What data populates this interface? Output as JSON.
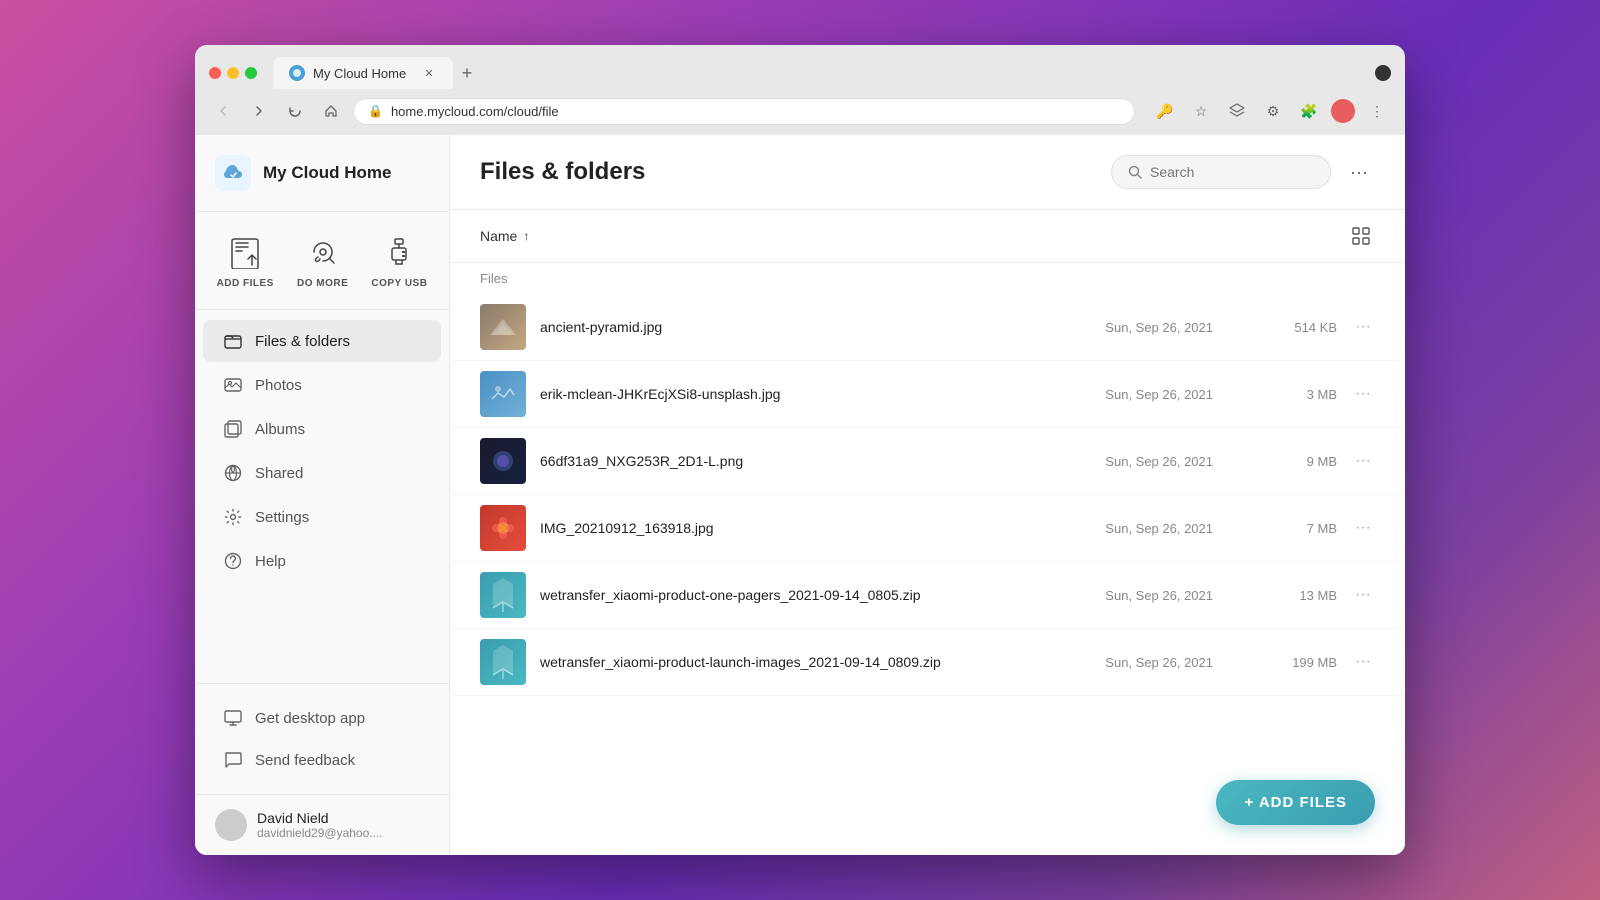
{
  "browser": {
    "tab_title": "My Cloud Home",
    "url": "home.mycloud.com/cloud/file",
    "new_tab_symbol": "+",
    "back_btn": "←",
    "forward_btn": "→",
    "refresh_btn": "↻",
    "home_btn": "⌂"
  },
  "sidebar": {
    "logo_text": "My Cloud Home",
    "actions": [
      {
        "id": "add-files",
        "label": "ADD FILES"
      },
      {
        "id": "do-more",
        "label": "DO MORE"
      },
      {
        "id": "copy-usb",
        "label": "COPY USB"
      }
    ],
    "nav_items": [
      {
        "id": "files-folders",
        "label": "Files & folders",
        "active": true
      },
      {
        "id": "photos",
        "label": "Photos",
        "active": false
      },
      {
        "id": "albums",
        "label": "Albums",
        "active": false
      },
      {
        "id": "shared",
        "label": "Shared",
        "active": false
      },
      {
        "id": "settings",
        "label": "Settings",
        "active": false
      },
      {
        "id": "help",
        "label": "Help",
        "active": false
      }
    ],
    "bottom_items": [
      {
        "id": "desktop-app",
        "label": "Get desktop app"
      },
      {
        "id": "feedback",
        "label": "Send feedback"
      }
    ],
    "user": {
      "name": "David Nield",
      "email": "davidnield29@yahoo...."
    }
  },
  "main": {
    "title": "Files & folders",
    "search_placeholder": "Search",
    "sort_label": "Name",
    "sort_direction": "↑",
    "section_label": "Files",
    "files": [
      {
        "id": "file-1",
        "name": "ancient-pyramid.jpg",
        "date": "Sun, Sep 26, 2021",
        "size": "514 KB",
        "type": "image",
        "thumb_color": "pyramid"
      },
      {
        "id": "file-2",
        "name": "erik-mclean-JHKrEcjXSi8-unsplash.jpg",
        "date": "Sun, Sep 26, 2021",
        "size": "3 MB",
        "type": "image",
        "thumb_color": "blue"
      },
      {
        "id": "file-3",
        "name": "66df31a9_NXG253R_2D1-L.png",
        "date": "Sun, Sep 26, 2021",
        "size": "9 MB",
        "type": "image",
        "thumb_color": "dark"
      },
      {
        "id": "file-4",
        "name": "IMG_20210912_163918.jpg",
        "date": "Sun, Sep 26, 2021",
        "size": "7 MB",
        "type": "image",
        "thumb_color": "flower"
      },
      {
        "id": "file-5",
        "name": "wetransfer_xiaomi-product-one-pagers_2021-09-14_0805.zip",
        "date": "Sun, Sep 26, 2021",
        "size": "13 MB",
        "type": "zip",
        "thumb_color": "zip"
      },
      {
        "id": "file-6",
        "name": "wetransfer_xiaomi-product-launch-images_2021-09-14_0809.zip",
        "date": "Sun, Sep 26, 2021",
        "size": "199 MB",
        "type": "zip",
        "thumb_color": "zip"
      }
    ],
    "add_files_label": "+ ADD FILES"
  }
}
